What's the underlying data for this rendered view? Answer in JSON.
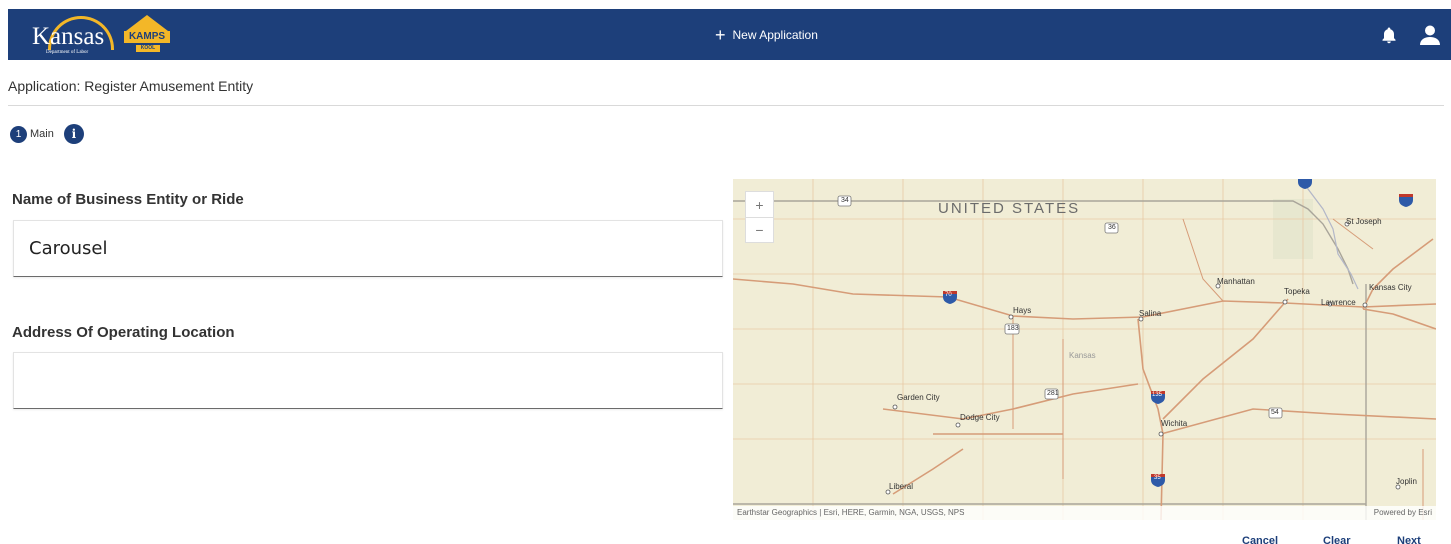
{
  "header": {
    "logo_word": "Kansas",
    "logo_sub": "Department of Labor",
    "logo_kamps": "KAMPS",
    "logo_kool": "KOOL",
    "new_application": "New Application",
    "brand_color": "#1d3f7a",
    "accent_color": "#f3b728",
    "icons": [
      "plus-icon",
      "bell-icon",
      "user-icon"
    ]
  },
  "page": {
    "title": "Application: Register Amusement Entity"
  },
  "steps": [
    {
      "number": "1",
      "label": "Main"
    }
  ],
  "form": {
    "business_name": {
      "label": "Name of Business Entity or Ride",
      "value": "Carousel"
    },
    "address": {
      "label": "Address Of Operating Location",
      "value": ""
    }
  },
  "map": {
    "region_label": "UNITED STATES",
    "state_label": "Kansas",
    "zoom_in": "+",
    "zoom_out": "−",
    "attribution": "Earthstar Geographics | Esri, HERE, Garmin, NGA, USGS, NPS",
    "powered_by": "Powered by Esri",
    "cities": [
      "St Joseph",
      "Manhattan",
      "Topeka",
      "Kansas City",
      "Lawrence",
      "Hays",
      "Salina",
      "Garden City",
      "Dodge City",
      "Wichita",
      "Liberal",
      "Joplin"
    ],
    "road_shields": [
      "34",
      "36",
      "70",
      "183",
      "281",
      "135",
      "54",
      "35"
    ]
  },
  "actions": {
    "cancel": "Cancel",
    "clear": "Clear",
    "next": "Next"
  }
}
